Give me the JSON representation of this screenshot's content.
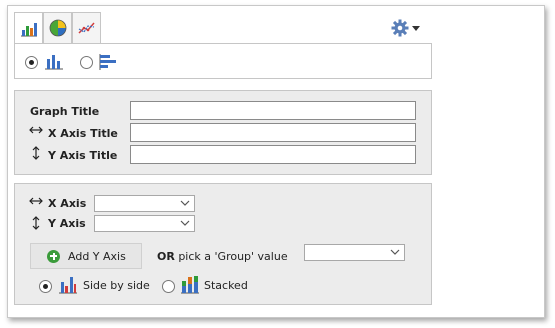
{
  "tabs": [
    {
      "name": "bar-chart",
      "icon": "bar-chart-icon",
      "active": true
    },
    {
      "name": "pie-chart",
      "icon": "pie-chart-icon",
      "active": false
    },
    {
      "name": "line-chart",
      "icon": "line-chart-icon",
      "active": false
    }
  ],
  "settings": {
    "icon": "gear-icon",
    "menu_icon": "caret-down-icon"
  },
  "orientation": {
    "options": [
      {
        "id": "vertical",
        "icon": "vertical-bars-icon",
        "selected": true
      },
      {
        "id": "horizontal",
        "icon": "horizontal-bars-icon",
        "selected": false
      }
    ]
  },
  "titles": {
    "graph_title_label": "Graph Title",
    "graph_title_value": "",
    "x_axis_title_label": "X Axis Title",
    "x_axis_title_value": "",
    "y_axis_title_label": "Y Axis Title",
    "y_axis_title_value": ""
  },
  "axes": {
    "x_axis_label": "X Axis",
    "x_axis_value": "",
    "y_axis_label": "Y Axis",
    "y_axis_value": "",
    "add_y_axis_label": "Add Y Axis",
    "or_label": "OR",
    "group_prompt": "pick a 'Group' value",
    "group_value": ""
  },
  "mode": {
    "side_by_side_label": "Side by side",
    "side_by_side_selected": true,
    "stacked_label": "Stacked",
    "stacked_selected": false
  },
  "colors": {
    "panel_bg": "#ececec",
    "bar_blue": "#3b6fc2",
    "pie_green": "#49a638",
    "pie_yellow": "#f2c21b",
    "pie_blue": "#2f6fc1",
    "add_green": "#3a9b3a"
  }
}
